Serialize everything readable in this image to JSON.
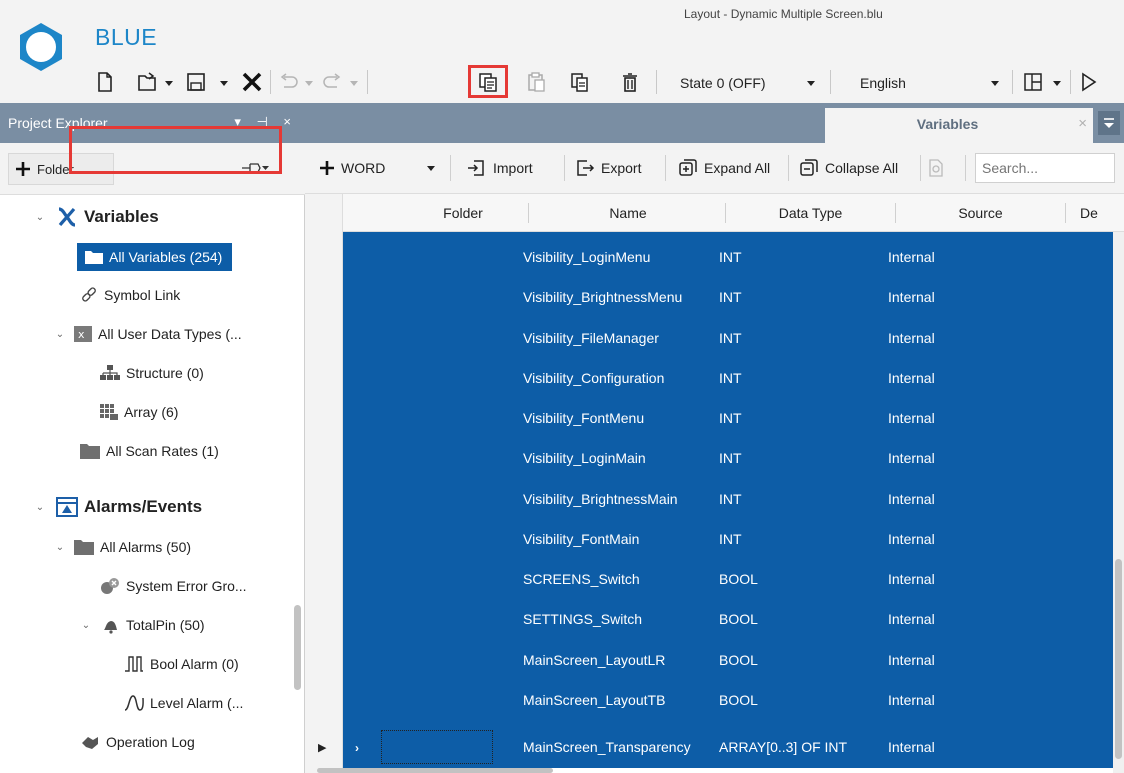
{
  "app": {
    "name": "BLUE",
    "window_title": "Layout - Dynamic Multiple Screen.blu",
    "brand_color": "#1d86c8"
  },
  "ribbon": {
    "state_select": "State 0 (OFF)",
    "language_select": "English",
    "icons": [
      "new-file-icon",
      "open-icon",
      "save-icon",
      "delete-icon",
      "undo-icon",
      "redo-icon",
      "copy-icon",
      "paste-icon",
      "duplicate-icon",
      "trash-icon",
      "layout-icon",
      "run-icon"
    ]
  },
  "project_explorer": {
    "title": "Project Explorer",
    "pin_controls": "▾ ⊣ ×",
    "folder_button": "Folder",
    "tree": {
      "variables": "Variables",
      "all_variables": "All Variables (254)",
      "symbol_link": "Symbol Link",
      "all_user_data_types": "All User Data Types (...",
      "structure": "Structure (0)",
      "array": "Array (6)",
      "all_scan_rates": "All Scan Rates (1)",
      "alarms_events": "Alarms/Events",
      "all_alarms": "All Alarms (50)",
      "system_error_group": "System Error Gro...",
      "total_pin": "TotalPin (50)",
      "bool_alarm": "Bool Alarm (0)",
      "level_alarm": "Level Alarm (...",
      "operation_log": "Operation Log"
    }
  },
  "tabs": {
    "active": "Variables"
  },
  "toolbar": {
    "word": "WORD",
    "import": "Import",
    "export": "Export",
    "expand_all": "Expand All",
    "collapse_all": "Collapse All",
    "search_placeholder": "Search..."
  },
  "grid": {
    "columns": [
      "Folder",
      "Name",
      "Data Type",
      "Source",
      "De"
    ],
    "selection_color": "#0d5da7",
    "rows": [
      {
        "name": "Visibility_LoginMenu",
        "type": "INT",
        "source": "Internal"
      },
      {
        "name": "Visibility_BrightnessMenu",
        "type": "INT",
        "source": "Internal"
      },
      {
        "name": "Visibility_FileManager",
        "type": "INT",
        "source": "Internal"
      },
      {
        "name": "Visibility_Configuration",
        "type": "INT",
        "source": "Internal"
      },
      {
        "name": "Visibility_FontMenu",
        "type": "INT",
        "source": "Internal"
      },
      {
        "name": "Visibility_LoginMain",
        "type": "INT",
        "source": "Internal"
      },
      {
        "name": "Visibility_BrightnessMain",
        "type": "INT",
        "source": "Internal"
      },
      {
        "name": "Visibility_FontMain",
        "type": "INT",
        "source": "Internal"
      },
      {
        "name": "SCREENS_Switch",
        "type": "BOOL",
        "source": "Internal"
      },
      {
        "name": "SETTINGS_Switch",
        "type": "BOOL",
        "source": "Internal"
      },
      {
        "name": "MainScreen_LayoutLR",
        "type": "BOOL",
        "source": "Internal"
      },
      {
        "name": "MainScreen_LayoutTB",
        "type": "BOOL",
        "source": "Internal"
      },
      {
        "name": "MainScreen_Transparency",
        "type": "ARRAY[0..3] OF INT",
        "source": "Internal"
      }
    ]
  }
}
